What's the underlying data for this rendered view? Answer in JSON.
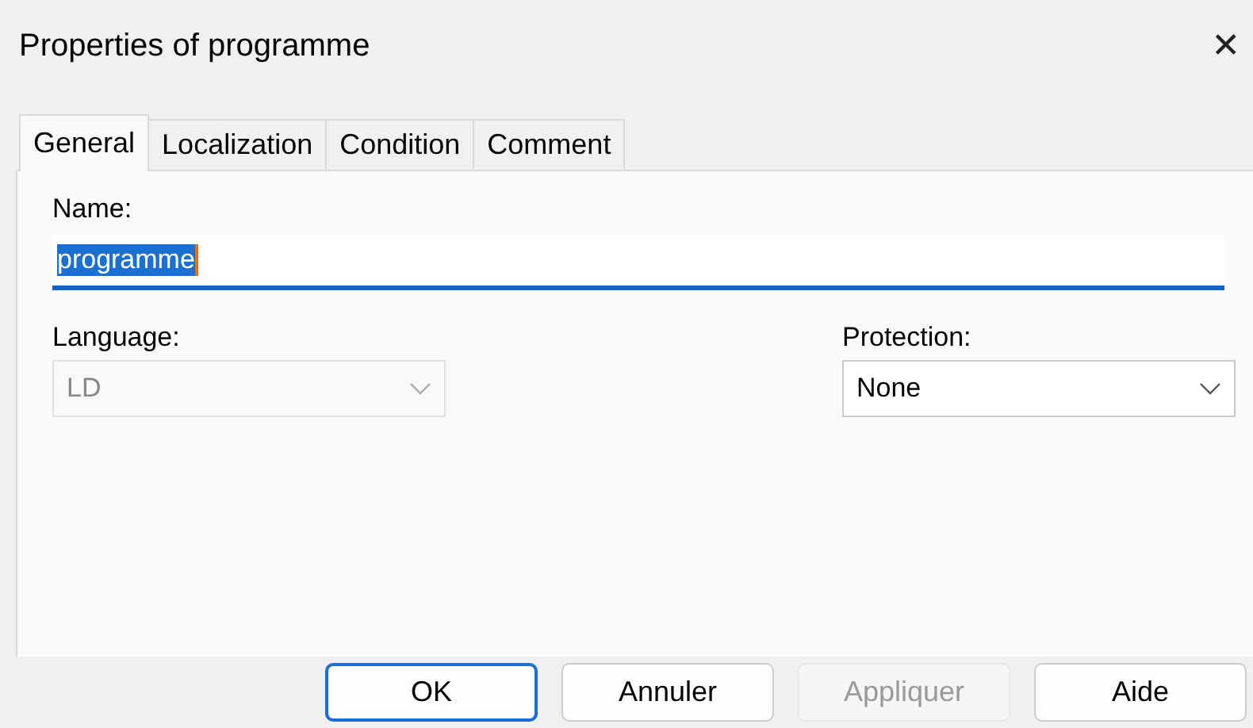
{
  "window": {
    "title": "Properties of programme",
    "close": "✕"
  },
  "tabs": [
    {
      "label": "General",
      "selected": true
    },
    {
      "label": "Localization",
      "selected": false
    },
    {
      "label": "Condition",
      "selected": false
    },
    {
      "label": "Comment",
      "selected": false
    }
  ],
  "name_field": {
    "label": "Name:",
    "value": "programme",
    "selected_text": true
  },
  "language": {
    "label": "Language:",
    "value": "LD",
    "disabled": true
  },
  "protection": {
    "label": "Protection:",
    "value": "None",
    "disabled": false
  },
  "buttons": [
    {
      "label": "OK",
      "default": true,
      "disabled": false
    },
    {
      "label": "Annuler",
      "default": false,
      "disabled": false
    },
    {
      "label": "Appliquer",
      "default": false,
      "disabled": true
    },
    {
      "label": "Aide",
      "default": false,
      "disabled": false
    }
  ]
}
